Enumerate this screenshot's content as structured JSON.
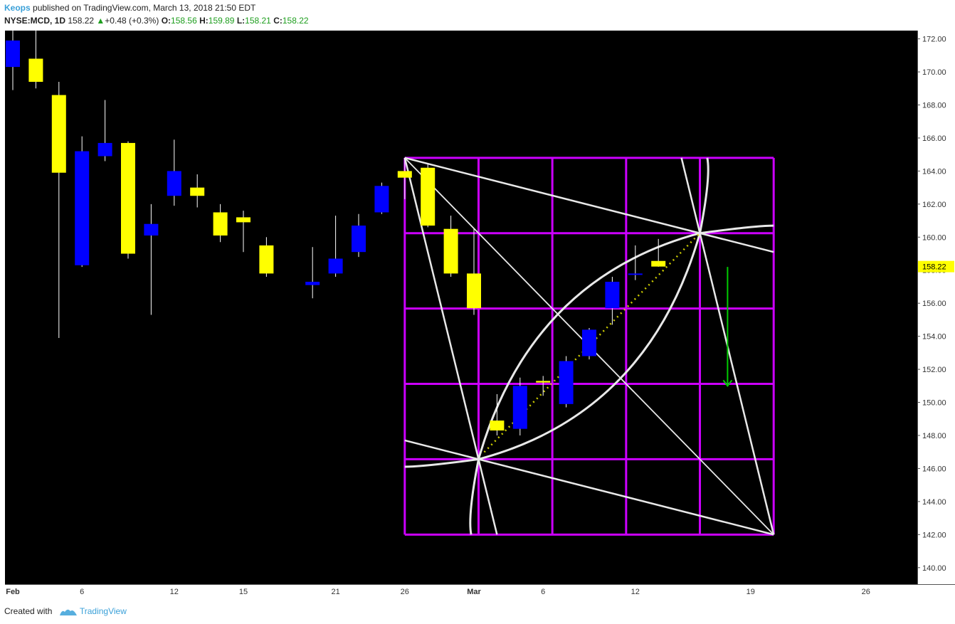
{
  "header": {
    "author": "Keops",
    "published_text": "published on TradingView.com, March 13, 2018 21:50 EDT",
    "symbol": "NYSE:MCD, 1D",
    "last_price": "158.22",
    "change_arrow": "▲",
    "change": "+0.48 (+0.3%)",
    "open_label": "O:",
    "open": "158.56",
    "high_label": "H:",
    "high": "159.89",
    "low_label": "L:",
    "low": "158.21",
    "close_label": "C:",
    "close": "158.22"
  },
  "footer": {
    "created_with": "Created with",
    "brand": "TradingView"
  },
  "colors": {
    "background": "#000000",
    "up_candle": "#0000ff",
    "down_candle": "#ffff00",
    "grid_overlay": "#cc00ff",
    "arcs": "#e8e8e8",
    "target_arrow": "#00cc00",
    "dotted_trend": "#cccc00",
    "price_tag_bg": "#ffff00"
  },
  "chart_data": {
    "type": "candlestick",
    "ylim": [
      139,
      172.5
    ],
    "y_ticks": [
      "140.00",
      "142.00",
      "144.00",
      "146.00",
      "148.00",
      "150.00",
      "152.00",
      "154.00",
      "156.00",
      "158.00",
      "160.00",
      "162.00",
      "164.00",
      "166.00",
      "168.00",
      "170.00",
      "172.00"
    ],
    "x_ticks": [
      {
        "label": "Feb",
        "date": "2018-02-01",
        "bold": true
      },
      {
        "label": "6",
        "date": "2018-02-06",
        "bold": false
      },
      {
        "label": "12",
        "date": "2018-02-12",
        "bold": false
      },
      {
        "label": "15",
        "date": "2018-02-15",
        "bold": false
      },
      {
        "label": "21",
        "date": "2018-02-21",
        "bold": false
      },
      {
        "label": "26",
        "date": "2018-02-26",
        "bold": false
      },
      {
        "label": "Mar",
        "date": "2018-03-01",
        "bold": true
      },
      {
        "label": "6",
        "date": "2018-03-06",
        "bold": false
      },
      {
        "label": "12",
        "date": "2018-03-12",
        "bold": false
      },
      {
        "label": "19",
        "date": "2018-03-19",
        "bold": false
      },
      {
        "label": "26",
        "date": "2018-03-26",
        "bold": false
      }
    ],
    "last_price_label": "158.22",
    "last_price": 158.22,
    "candles": [
      {
        "date": "2018-02-01",
        "o": 170.3,
        "h": 172.5,
        "l": 168.9,
        "c": 171.9
      },
      {
        "date": "2018-02-02",
        "o": 170.8,
        "h": 172.5,
        "l": 169.0,
        "c": 169.4
      },
      {
        "date": "2018-02-05",
        "o": 168.6,
        "h": 169.4,
        "l": 153.9,
        "c": 163.9
      },
      {
        "date": "2018-02-06",
        "o": 158.3,
        "h": 166.1,
        "l": 158.2,
        "c": 165.2
      },
      {
        "date": "2018-02-07",
        "o": 164.9,
        "h": 168.3,
        "l": 164.6,
        "c": 165.7
      },
      {
        "date": "2018-02-08",
        "o": 165.7,
        "h": 165.8,
        "l": 158.7,
        "c": 159.0
      },
      {
        "date": "2018-02-09",
        "o": 160.1,
        "h": 162.0,
        "l": 155.3,
        "c": 160.8
      },
      {
        "date": "2018-02-12",
        "o": 162.5,
        "h": 165.9,
        "l": 161.9,
        "c": 164.0
      },
      {
        "date": "2018-02-13",
        "o": 163.0,
        "h": 163.8,
        "l": 161.8,
        "c": 162.5
      },
      {
        "date": "2018-02-14",
        "o": 161.5,
        "h": 162.0,
        "l": 159.7,
        "c": 160.1
      },
      {
        "date": "2018-02-15",
        "o": 161.2,
        "h": 161.6,
        "l": 159.1,
        "c": 160.9
      },
      {
        "date": "2018-02-16",
        "o": 159.5,
        "h": 160.0,
        "l": 157.6,
        "c": 157.8
      },
      {
        "date": "2018-02-20",
        "o": 157.1,
        "h": 159.4,
        "l": 156.3,
        "c": 157.3
      },
      {
        "date": "2018-02-21",
        "o": 157.8,
        "h": 161.3,
        "l": 157.6,
        "c": 158.7
      },
      {
        "date": "2018-02-22",
        "o": 159.1,
        "h": 161.4,
        "l": 158.8,
        "c": 160.7
      },
      {
        "date": "2018-02-23",
        "o": 161.5,
        "h": 163.3,
        "l": 161.4,
        "c": 163.1
      },
      {
        "date": "2018-02-26",
        "o": 164.0,
        "h": 164.8,
        "l": 162.3,
        "c": 163.6
      },
      {
        "date": "2018-02-27",
        "o": 164.2,
        "h": 164.4,
        "l": 160.6,
        "c": 160.7
      },
      {
        "date": "2018-02-28",
        "o": 160.5,
        "h": 161.3,
        "l": 157.6,
        "c": 157.8
      },
      {
        "date": "2018-03-01",
        "o": 157.8,
        "h": 160.5,
        "l": 155.3,
        "c": 155.7
      },
      {
        "date": "2018-03-02",
        "o": 148.9,
        "h": 150.5,
        "l": 148.0,
        "c": 148.3
      },
      {
        "date": "2018-03-05",
        "o": 148.4,
        "h": 151.5,
        "l": 148.0,
        "c": 151.0
      },
      {
        "date": "2018-03-06",
        "o": 151.3,
        "h": 151.6,
        "l": 150.4,
        "c": 151.2
      },
      {
        "date": "2018-03-07",
        "o": 149.9,
        "h": 152.8,
        "l": 149.7,
        "c": 152.5
      },
      {
        "date": "2018-03-08",
        "o": 152.8,
        "h": 154.5,
        "l": 152.6,
        "c": 154.4
      },
      {
        "date": "2018-03-09",
        "o": 155.7,
        "h": 157.6,
        "l": 154.7,
        "c": 157.3
      },
      {
        "date": "2018-03-12",
        "o": 157.8,
        "h": 159.5,
        "l": 157.4,
        "c": 157.8
      },
      {
        "date": "2018-03-13",
        "o": 158.56,
        "h": 159.89,
        "l": 158.21,
        "c": 158.22
      }
    ],
    "overlay_box": {
      "from_date": "2018-02-26",
      "to_date": "2018-03-20",
      "price_low": 142.0,
      "price_high": 164.8
    },
    "target_arrow": {
      "date": "2018-03-16",
      "from": 158.2,
      "to": 151.0
    }
  }
}
